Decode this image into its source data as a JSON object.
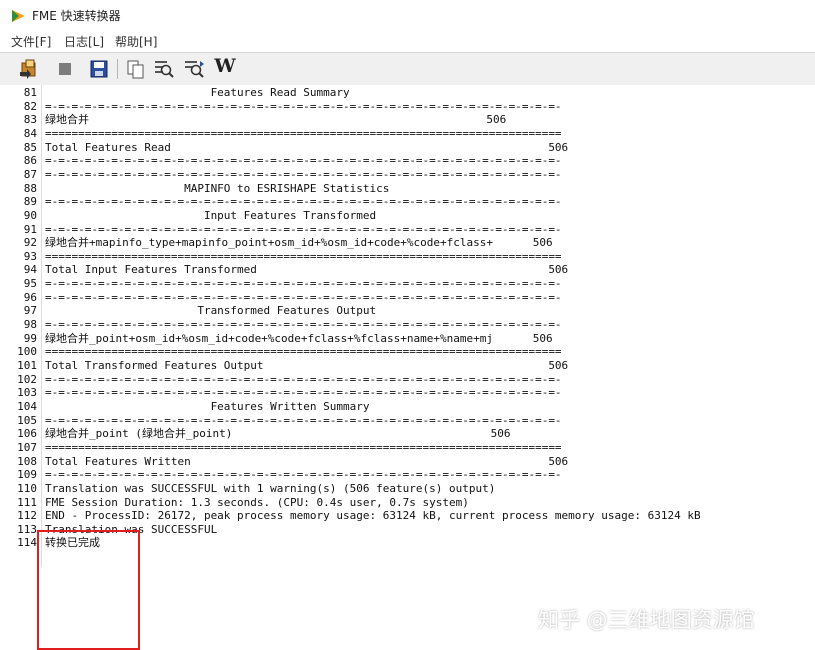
{
  "window": {
    "title": "FME 快速转换器"
  },
  "menu": [
    {
      "label": "文件[F]"
    },
    {
      "label": "日志[L]"
    },
    {
      "label": "帮助[H]"
    }
  ],
  "toolbar": {
    "buttons": [
      {
        "icon": "run-translation-icon"
      },
      {
        "icon": "stop-icon"
      },
      {
        "icon": "save-icon"
      },
      {
        "icon": "copy-icon"
      },
      {
        "icon": "find-icon"
      },
      {
        "icon": "find-next-icon"
      },
      {
        "icon": "word-wrap-icon",
        "glyph": "W"
      }
    ]
  },
  "log": {
    "lines": [
      {
        "n": "81",
        "t": "                         Features Read Summary"
      },
      {
        "n": "82",
        "t": "=-=-=-=-=-=-=-=-=-=-=-=-=-=-=-=-=-=-=-=-=-=-=-=-=-=-=-=-=-=-=-=-=-=-=-=-=-=-=-"
      },
      {
        "n": "83",
        "t": "绿地合并                                                            506"
      },
      {
        "n": "84",
        "t": "=============================================================================="
      },
      {
        "n": "85",
        "t": "Total Features Read                                                         506"
      },
      {
        "n": "86",
        "t": "=-=-=-=-=-=-=-=-=-=-=-=-=-=-=-=-=-=-=-=-=-=-=-=-=-=-=-=-=-=-=-=-=-=-=-=-=-=-=-"
      },
      {
        "n": "87",
        "t": "=-=-=-=-=-=-=-=-=-=-=-=-=-=-=-=-=-=-=-=-=-=-=-=-=-=-=-=-=-=-=-=-=-=-=-=-=-=-=-"
      },
      {
        "n": "88",
        "t": "                     MAPINFO to ESRISHAPE Statistics"
      },
      {
        "n": "89",
        "t": "=-=-=-=-=-=-=-=-=-=-=-=-=-=-=-=-=-=-=-=-=-=-=-=-=-=-=-=-=-=-=-=-=-=-=-=-=-=-=-"
      },
      {
        "n": "90",
        "t": "                        Input Features Transformed"
      },
      {
        "n": "91",
        "t": "=-=-=-=-=-=-=-=-=-=-=-=-=-=-=-=-=-=-=-=-=-=-=-=-=-=-=-=-=-=-=-=-=-=-=-=-=-=-=-"
      },
      {
        "n": "92",
        "t": "绿地合并+mapinfo_type+mapinfo_point+osm_id+%osm_id+code+%code+fclass+      506"
      },
      {
        "n": "93",
        "t": "=============================================================================="
      },
      {
        "n": "94",
        "t": "Total Input Features Transformed                                            506"
      },
      {
        "n": "95",
        "t": "=-=-=-=-=-=-=-=-=-=-=-=-=-=-=-=-=-=-=-=-=-=-=-=-=-=-=-=-=-=-=-=-=-=-=-=-=-=-=-"
      },
      {
        "n": "96",
        "t": "=-=-=-=-=-=-=-=-=-=-=-=-=-=-=-=-=-=-=-=-=-=-=-=-=-=-=-=-=-=-=-=-=-=-=-=-=-=-=-"
      },
      {
        "n": "97",
        "t": "                       Transformed Features Output"
      },
      {
        "n": "98",
        "t": "=-=-=-=-=-=-=-=-=-=-=-=-=-=-=-=-=-=-=-=-=-=-=-=-=-=-=-=-=-=-=-=-=-=-=-=-=-=-=-"
      },
      {
        "n": "99",
        "t": "绿地合并_point+osm_id+%osm_id+code+%code+fclass+%fclass+name+%name+mj      506"
      },
      {
        "n": "100",
        "t": "=============================================================================="
      },
      {
        "n": "101",
        "t": "Total Transformed Features Output                                           506"
      },
      {
        "n": "102",
        "t": "=-=-=-=-=-=-=-=-=-=-=-=-=-=-=-=-=-=-=-=-=-=-=-=-=-=-=-=-=-=-=-=-=-=-=-=-=-=-=-"
      },
      {
        "n": "103",
        "t": "=-=-=-=-=-=-=-=-=-=-=-=-=-=-=-=-=-=-=-=-=-=-=-=-=-=-=-=-=-=-=-=-=-=-=-=-=-=-=-"
      },
      {
        "n": "104",
        "t": "                         Features Written Summary"
      },
      {
        "n": "105",
        "t": "=-=-=-=-=-=-=-=-=-=-=-=-=-=-=-=-=-=-=-=-=-=-=-=-=-=-=-=-=-=-=-=-=-=-=-=-=-=-=-"
      },
      {
        "n": "106",
        "t": "绿地合并_point (绿地合并_point)                                       506"
      },
      {
        "n": "107",
        "t": "=============================================================================="
      },
      {
        "n": "108",
        "t": "Total Features Written                                                      506"
      },
      {
        "n": "109",
        "t": "=-=-=-=-=-=-=-=-=-=-=-=-=-=-=-=-=-=-=-=-=-=-=-=-=-=-=-=-=-=-=-=-=-=-=-=-=-=-=-"
      },
      {
        "n": "110",
        "t": "Translation was SUCCESSFUL with 1 warning(s) (506 feature(s) output)"
      },
      {
        "n": "111",
        "t": "FME Session Duration: 1.3 seconds. (CPU: 0.4s user, 0.7s system)"
      },
      {
        "n": "112",
        "t": "END - ProcessID: 26172, peak process memory usage: 63124 kB, current process memory usage: 63124 kB"
      },
      {
        "n": "113",
        "t": "Translation was SUCCESSFUL"
      },
      {
        "n": "114",
        "t": "转换已完成"
      }
    ]
  },
  "watermark": "知乎 @三维地图资源馆",
  "colors": {
    "highlight": "#e11d1d",
    "toolbar_bg": "#f0f0f0"
  }
}
